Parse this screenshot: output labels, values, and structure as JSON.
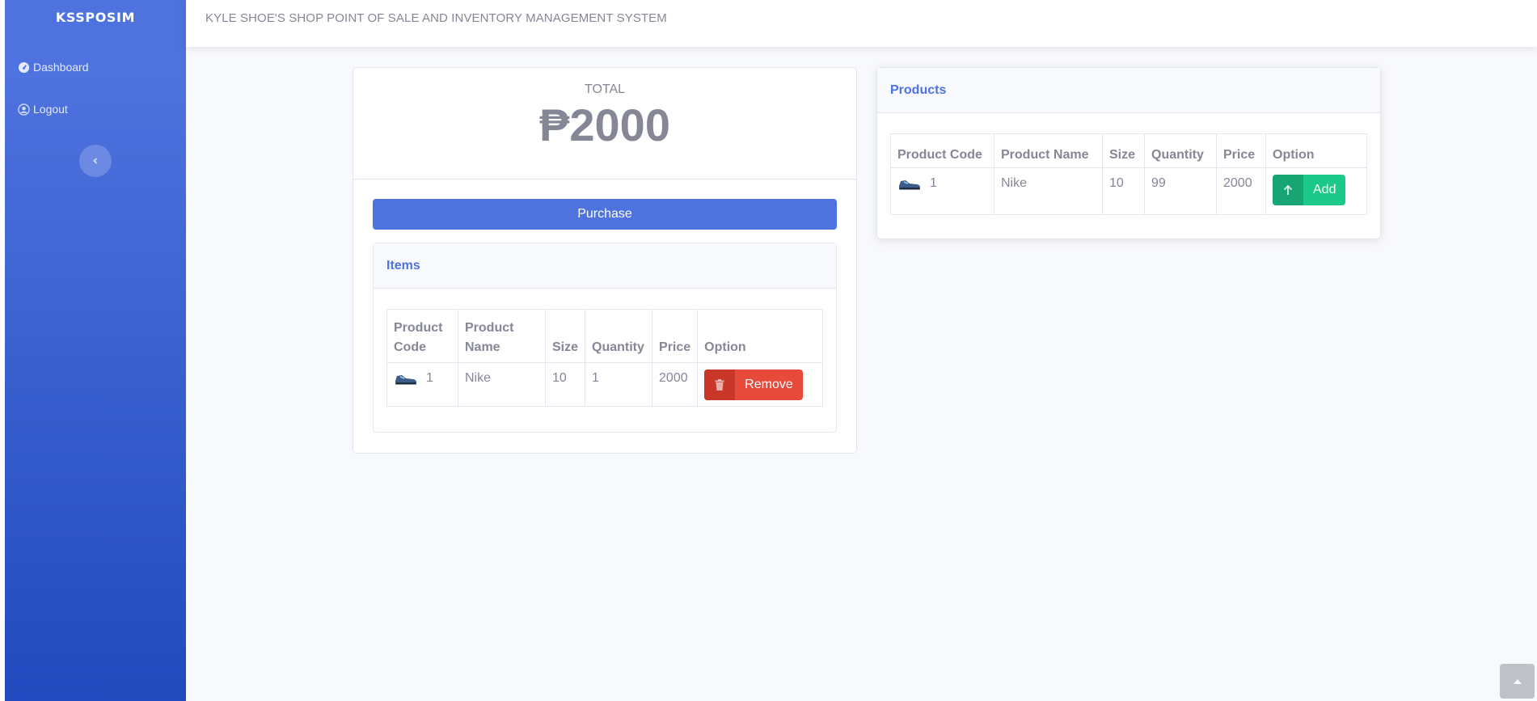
{
  "sidebar": {
    "brand": "KSSPOSIM",
    "items": [
      {
        "label": "Dashboard",
        "icon": "tachometer-icon"
      },
      {
        "label": "Logout",
        "icon": "user-circle-icon"
      }
    ],
    "toggle_icon": "chevron-left-icon"
  },
  "topbar": {
    "title": "KYLE SHOE'S SHOP POINT OF SALE AND INVENTORY MANAGEMENT SYSTEM"
  },
  "total": {
    "label": "TOTAL",
    "value": "₱2000"
  },
  "purchase_label": "Purchase",
  "items": {
    "title": "Items",
    "columns": [
      "Product Code",
      "Product Name",
      "Size",
      "Quantity",
      "Price",
      "Option"
    ],
    "rows": [
      {
        "code": "1",
        "name": "Nike",
        "size": "10",
        "quantity": "1",
        "price": "2000",
        "option": "Remove"
      }
    ]
  },
  "products": {
    "title": "Products",
    "columns": [
      "Product Code",
      "Product Name",
      "Size",
      "Quantity",
      "Price",
      "Option"
    ],
    "rows": [
      {
        "code": "1",
        "name": "Nike",
        "size": "10",
        "quantity": "99",
        "price": "2000",
        "option": "Add"
      }
    ]
  },
  "colors": {
    "primary": "#4e73df",
    "danger": "#e74a3b",
    "success": "#1cc88a",
    "text": "#858796"
  }
}
